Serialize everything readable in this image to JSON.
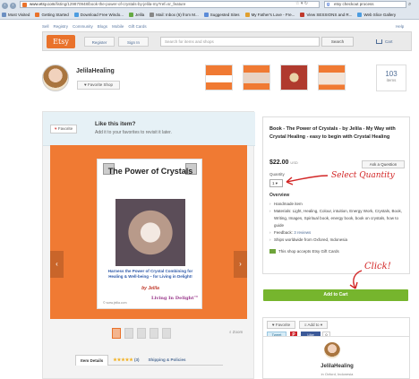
{
  "browser": {
    "url_host": "www.etsy.com",
    "url_path": "/listing/129870948/book-the-power-of-crystals-by-jelila-my?ref=sr_feature",
    "search_value": "etsy checkout process",
    "bookmarks": [
      {
        "label": "Most Visited",
        "color": "#6b8fc1"
      },
      {
        "label": "Getting Started",
        "color": "#e9722b"
      },
      {
        "label": "Download Free Windo...",
        "color": "#4d9de0"
      },
      {
        "label": "Jelila",
        "color": "#66aa44"
      },
      {
        "label": "Mail: Inbox (6) from M...",
        "color": "#888888"
      },
      {
        "label": "Suggested Sites",
        "color": "#5b8bd8"
      },
      {
        "label": "My Father's Love - Fre...",
        "color": "#e0a030"
      },
      {
        "label": "View SESSIONS and R...",
        "color": "#c0392b"
      },
      {
        "label": "Web Slice Gallery",
        "color": "#4d9de0"
      }
    ]
  },
  "etsy": {
    "top_links": [
      "Sell",
      "Registry",
      "Community",
      "Blogs",
      "Mobile",
      "Gift Cards"
    ],
    "help": "Help",
    "logo": "Etsy",
    "register": "Register",
    "sign_in": "Sign In",
    "search_placeholder": "Search for items and shops",
    "search_button": "Search",
    "cart": "Cart"
  },
  "shop": {
    "name": "JelilaHealing",
    "favorite_shop": "Favorite Shop",
    "item_count": "103",
    "item_label": "items"
  },
  "listing": {
    "like_title": "Like this item?",
    "like_sub": "Add it to your favorites to revisit it later.",
    "favorite": "Favorite",
    "book": {
      "title": "The Power of Crystals",
      "subtitle": "Harness the Power of Crystal Combining for Healing & Well-being – for Living in Delight!",
      "author": "by Jelila",
      "brand": "Living In Delight™",
      "url": "© www.jelila.com"
    },
    "zoom": "Zoom",
    "tabs": {
      "item_details": "Item Details",
      "reviews_count": "(3)",
      "shipping": "Shipping & Policies"
    }
  },
  "product": {
    "title": "Book - The Power of Crystals - by Jelila - My Way with Crystal Healing - easy to begin with Crystal Healing",
    "price": "$22.00",
    "currency": "USD",
    "ask_question": "Ask a Question",
    "quantity_label": "Quantity",
    "quantity_value": "1",
    "overview_heading": "Overview",
    "overview_items": [
      "Handmade item",
      "Materials: Light, Healing, Colour, intuition, Energy Work, Crystals, Book, Writing, Images, Spiritual book, energy book, book on crystals, how to guide",
      "Ships worldwide from Oxfored, Indonesia"
    ],
    "feedback_label": "Feedback:",
    "feedback_link": "3 reviews",
    "gift_cards": "This shop accepts Etsy Gift Cards",
    "add_to_cart": "Add to Cart"
  },
  "social": {
    "favorite": "Favorite",
    "add_to": "Add to",
    "tweet": "Tweet",
    "like": "Like",
    "like_count": "0"
  },
  "seller": {
    "name": "JelilaHealing",
    "location": "in Oxford, Indonesia"
  },
  "annotations": {
    "select_quantity": "Select Quantity",
    "click": "Click!",
    "color": "#d22525"
  }
}
